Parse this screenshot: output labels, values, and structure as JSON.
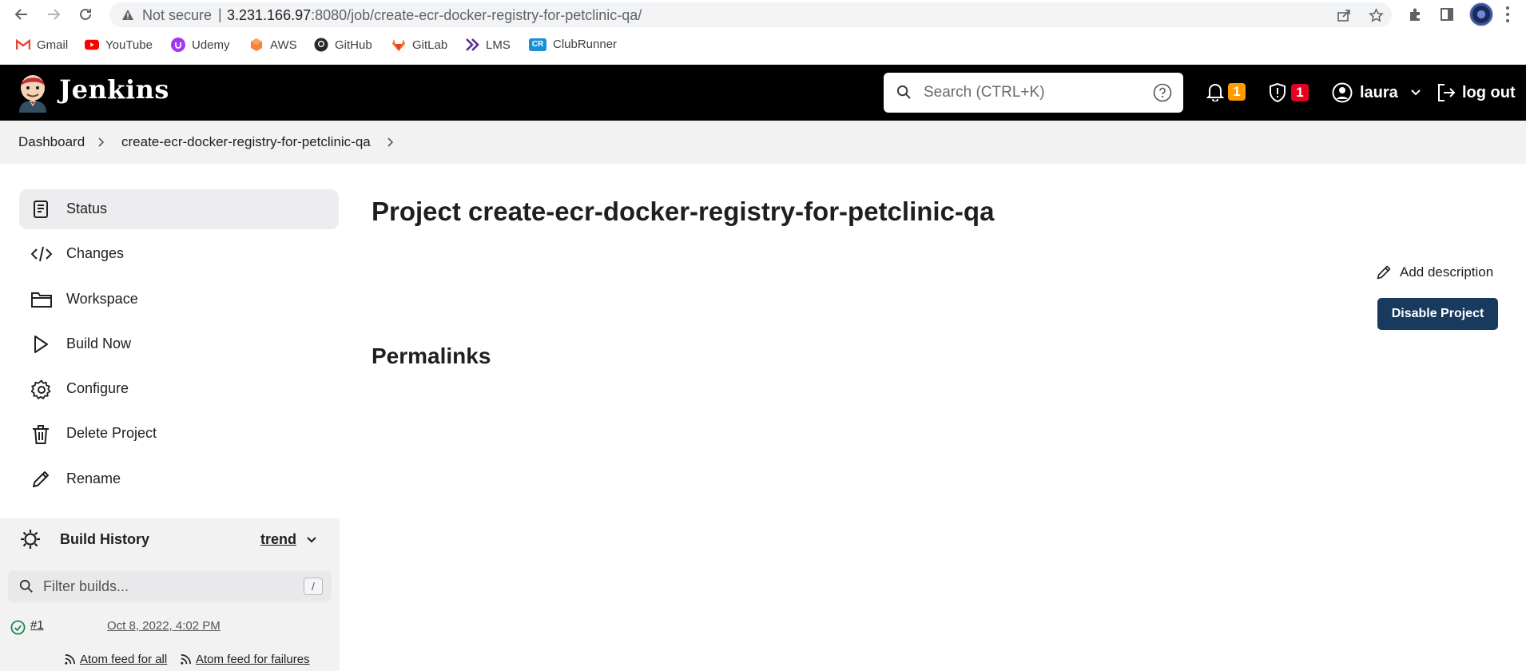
{
  "browser": {
    "security_label": "Not secure",
    "separator": "|",
    "url_host": "3.231.166.97",
    "url_rest": ":8080/job/create-ecr-docker-registry-for-petclinic-qa/",
    "bookmarks": [
      {
        "label": "Gmail",
        "icon": "gmail-icon"
      },
      {
        "label": "YouTube",
        "icon": "youtube-icon"
      },
      {
        "label": "Udemy",
        "icon": "udemy-icon"
      },
      {
        "label": "AWS",
        "icon": "aws-icon"
      },
      {
        "label": "GitHub",
        "icon": "github-icon"
      },
      {
        "label": "GitLab",
        "icon": "gitlab-icon"
      },
      {
        "label": "LMS",
        "icon": "lms-icon"
      },
      {
        "label": "ClubRunner",
        "icon": "clubrunner-icon",
        "icon_text": "CR"
      }
    ]
  },
  "header": {
    "brand": "Jenkins",
    "search_placeholder": "Search (CTRL+K)",
    "notifications_count": "1",
    "security_count": "1",
    "user": "laura",
    "logout": "log out",
    "colors": {
      "background": "#000000",
      "notify_badge": "#ff9a00",
      "security_badge": "#e6001f"
    }
  },
  "breadcrumb": {
    "items": [
      "Dashboard",
      "create-ecr-docker-registry-for-petclinic-qa"
    ]
  },
  "sidebar": {
    "tasks": [
      {
        "label": "Status",
        "icon": "notepad-icon",
        "active": true
      },
      {
        "label": "Changes",
        "icon": "code-icon"
      },
      {
        "label": "Workspace",
        "icon": "folder-icon"
      },
      {
        "label": "Build Now",
        "icon": "play-icon"
      },
      {
        "label": "Configure",
        "icon": "gear-icon"
      },
      {
        "label": "Delete Project",
        "icon": "trash-icon"
      },
      {
        "label": "Rename",
        "icon": "pencil-icon"
      }
    ]
  },
  "build_history": {
    "title": "Build History",
    "trend": "trend",
    "filter_placeholder": "Filter builds...",
    "filter_shortcut": "/",
    "builds": [
      {
        "number": "#1",
        "date": "Oct 8, 2022, 4:02 PM",
        "status": "success"
      }
    ],
    "feeds": {
      "all": "Atom feed for all",
      "failures": "Atom feed for failures"
    }
  },
  "main": {
    "title": "Project create-ecr-docker-registry-for-petclinic-qa",
    "add_description": "Add description",
    "disable_button": "Disable Project",
    "permalinks_title": "Permalinks",
    "colors": {
      "primary_button": "#173a5e"
    }
  }
}
